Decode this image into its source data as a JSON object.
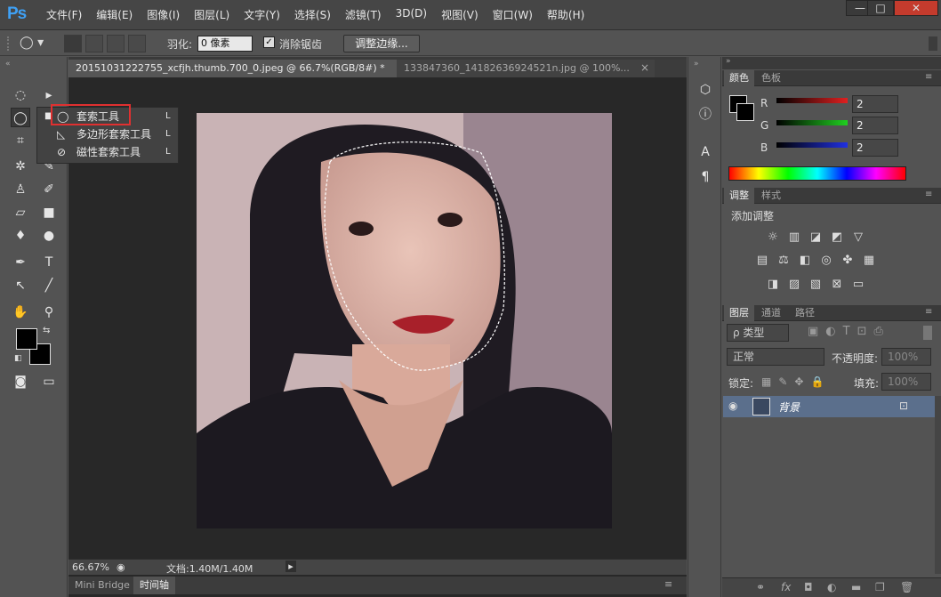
{
  "app": {
    "logo": "Ps"
  },
  "menu": [
    "文件(F)",
    "编辑(E)",
    "图像(I)",
    "图层(L)",
    "文字(Y)",
    "选择(S)",
    "滤镜(T)",
    "3D(D)",
    "视图(V)",
    "窗口(W)",
    "帮助(H)"
  ],
  "window_controls": {
    "minimize": "—",
    "maximize": "□",
    "close": "✕"
  },
  "options": {
    "feather_label": "羽化:",
    "feather_value": "0 像素",
    "antialias_label": "消除锯齿",
    "antialias_checked": "✓",
    "refine_button": "调整边缘..."
  },
  "tabs": [
    {
      "label": "20151031222755_xcfjh.thumb.700_0.jpeg @ 66.7%(RGB/8#) *",
      "close": "×"
    },
    {
      "label": "133847360_14182636924521n.jpg @ 100%...",
      "close": "×"
    }
  ],
  "flyout": {
    "items": [
      {
        "label": "套索工具",
        "key": "L",
        "selected": true
      },
      {
        "label": "多边形套索工具",
        "key": "L"
      },
      {
        "label": "磁性套索工具",
        "key": "L"
      }
    ]
  },
  "status": {
    "zoom": "66.67%",
    "doc_info": "文档:1.40M/1.40M"
  },
  "bottom_tabs": [
    "Mini Bridge",
    "时间轴"
  ],
  "color_panel": {
    "tabs": [
      "颜色",
      "色板"
    ],
    "channels": [
      {
        "label": "R",
        "value": "2",
        "color": "#e02020"
      },
      {
        "label": "G",
        "value": "2",
        "color": "#20d020"
      },
      {
        "label": "B",
        "value": "2",
        "color": "#2030e0"
      }
    ]
  },
  "adjust_panel": {
    "tabs": [
      "调整",
      "样式"
    ],
    "title": "添加调整"
  },
  "layers_panel": {
    "tabs": [
      "图层",
      "通道",
      "路径"
    ],
    "filter_label": "ρ 类型",
    "blend_mode": "正常",
    "opacity_label": "不透明度:",
    "opacity_value": "100%",
    "lock_label": "锁定:",
    "fill_label": "填充:",
    "fill_value": "100%",
    "layer_name": "背景"
  },
  "footer_icons": [
    "link-icon",
    "fx-icon",
    "mask-icon",
    "adjustment-icon",
    "folder-icon",
    "new-layer-icon",
    "trash-icon"
  ],
  "accent": "#3fa0f4",
  "highlight_box": "#e03030"
}
